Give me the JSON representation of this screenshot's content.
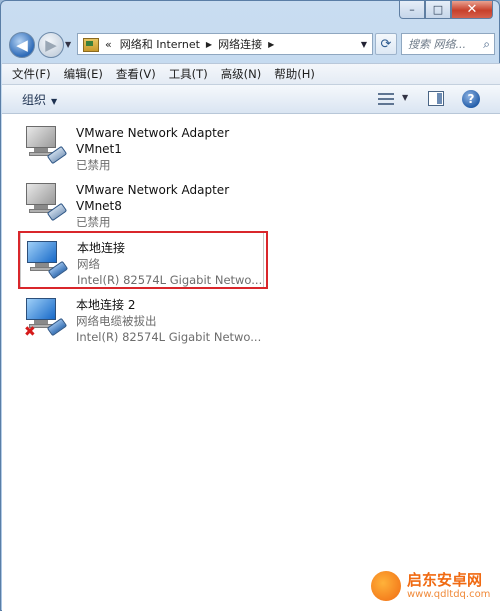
{
  "address": {
    "overflow": "«",
    "crumbs": [
      "网络和 Internet",
      "网络连接"
    ]
  },
  "search": {
    "placeholder": "搜索 网络..."
  },
  "window_controls": {
    "minimize": "–",
    "maximize": "□",
    "close": "✕"
  },
  "menu": [
    "文件(F)",
    "编辑(E)",
    "查看(V)",
    "工具(T)",
    "高级(N)",
    "帮助(H)"
  ],
  "command_bar": {
    "organize": "组织"
  },
  "adapters": [
    {
      "name": "VMware Network Adapter",
      "line2": "VMnet1",
      "status": "已禁用",
      "icon": "network-adapter-disabled"
    },
    {
      "name": "VMware Network Adapter",
      "line2": "VMnet8",
      "status": "已禁用",
      "icon": "network-adapter-disabled"
    },
    {
      "name": "本地连接",
      "line2": "网络",
      "status": "Intel(R) 82574L Gigabit Netwo...",
      "icon": "network-adapter-connected"
    },
    {
      "name": "本地连接 2",
      "line2": "网络电缆被拔出",
      "status": "Intel(R) 82574L Gigabit Netwo...",
      "icon": "network-adapter-unplugged"
    }
  ],
  "watermark": {
    "title": "启东安卓网",
    "url": "www.qdltdq.com"
  },
  "colors": {
    "highlight_border": "#d9262b",
    "disabled_text": "#6d6d6d"
  }
}
